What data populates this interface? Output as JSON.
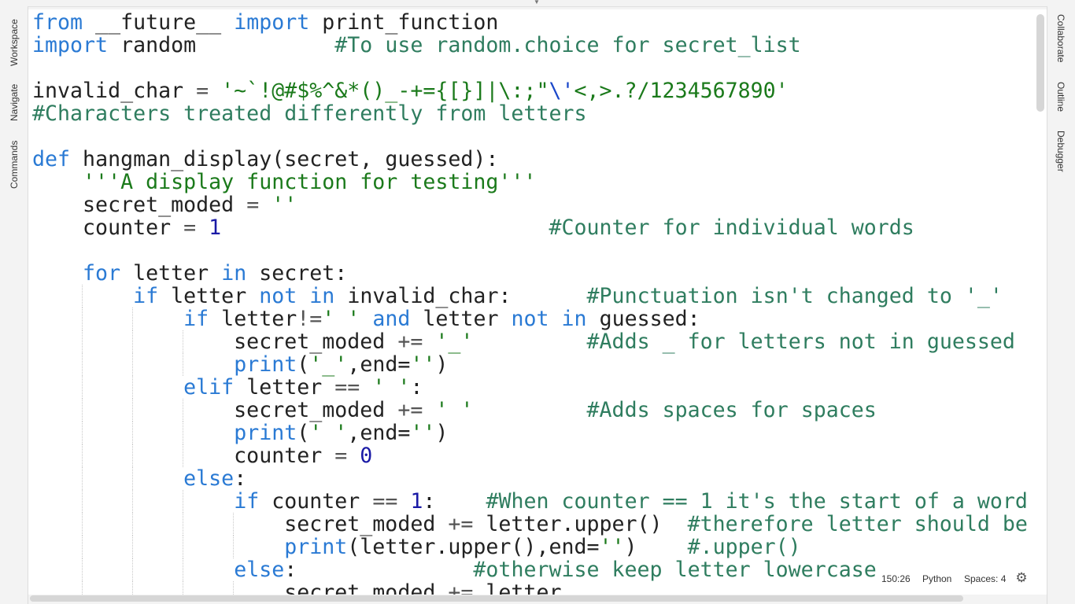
{
  "sidebar_left": {
    "items": [
      "Workspace",
      "Navigate",
      "Commands"
    ]
  },
  "sidebar_right": {
    "items": [
      "Collaborate",
      "Outline",
      "Debugger"
    ]
  },
  "status": {
    "position": "150:26",
    "language": "Python",
    "indent": "Spaces: 4"
  },
  "icons": {
    "settings": "gear-icon",
    "collapse": "chevron-down-icon"
  },
  "code": {
    "lines": [
      [
        {
          "t": "kw",
          "v": "from"
        },
        {
          "t": "",
          "v": " __future__ "
        },
        {
          "t": "kw",
          "v": "import"
        },
        {
          "t": "",
          "v": " print_function"
        }
      ],
      [
        {
          "t": "kw",
          "v": "import"
        },
        {
          "t": "",
          "v": " random           "
        },
        {
          "t": "com",
          "v": "#To use random.choice for secret_list"
        }
      ],
      [],
      [
        {
          "t": "",
          "v": "invalid_char "
        },
        {
          "t": "op",
          "v": "="
        },
        {
          "t": "",
          "v": " "
        },
        {
          "t": "str",
          "v": "'~`!@#$%^&*()_-+={[}]|\\:;\""
        },
        {
          "t": "esc",
          "v": "\\'"
        },
        {
          "t": "str",
          "v": "<,>.?/1234567890'"
        }
      ],
      [
        {
          "t": "com",
          "v": "#Characters treated differently from letters"
        }
      ],
      [],
      [
        {
          "t": "kw",
          "v": "def"
        },
        {
          "t": "",
          "v": " hangman_display(secret, guessed):"
        }
      ],
      [
        {
          "t": "",
          "v": "    "
        },
        {
          "t": "str",
          "v": "'''A display function for testing'''"
        }
      ],
      [
        {
          "t": "",
          "v": "    secret_moded "
        },
        {
          "t": "op",
          "v": "="
        },
        {
          "t": "",
          "v": " "
        },
        {
          "t": "str",
          "v": "''"
        }
      ],
      [
        {
          "t": "",
          "v": "    counter "
        },
        {
          "t": "op",
          "v": "="
        },
        {
          "t": "",
          "v": " "
        },
        {
          "t": "num",
          "v": "1"
        },
        {
          "t": "",
          "v": "                          "
        },
        {
          "t": "com",
          "v": "#Counter for individual words"
        }
      ],
      [],
      [
        {
          "t": "",
          "v": "    "
        },
        {
          "t": "kw",
          "v": "for"
        },
        {
          "t": "",
          "v": " letter "
        },
        {
          "t": "kw",
          "v": "in"
        },
        {
          "t": "",
          "v": " secret:"
        }
      ],
      [
        {
          "t": "",
          "v": "        "
        },
        {
          "t": "kw",
          "v": "if"
        },
        {
          "t": "",
          "v": " letter "
        },
        {
          "t": "kw",
          "v": "not"
        },
        {
          "t": "",
          "v": " "
        },
        {
          "t": "kw",
          "v": "in"
        },
        {
          "t": "",
          "v": " invalid_char:      "
        },
        {
          "t": "com",
          "v": "#Punctuation isn't changed to '_'"
        }
      ],
      [
        {
          "t": "",
          "v": "            "
        },
        {
          "t": "kw",
          "v": "if"
        },
        {
          "t": "",
          "v": " letter"
        },
        {
          "t": "op",
          "v": "!="
        },
        {
          "t": "str",
          "v": "' '"
        },
        {
          "t": "",
          "v": " "
        },
        {
          "t": "kw",
          "v": "and"
        },
        {
          "t": "",
          "v": " letter "
        },
        {
          "t": "kw",
          "v": "not"
        },
        {
          "t": "",
          "v": " "
        },
        {
          "t": "kw",
          "v": "in"
        },
        {
          "t": "",
          "v": " guessed:"
        }
      ],
      [
        {
          "t": "",
          "v": "                secret_moded "
        },
        {
          "t": "op",
          "v": "+="
        },
        {
          "t": "",
          "v": " "
        },
        {
          "t": "str",
          "v": "'_'"
        },
        {
          "t": "",
          "v": "         "
        },
        {
          "t": "com",
          "v": "#Adds _ for letters not in guessed"
        }
      ],
      [
        {
          "t": "",
          "v": "                "
        },
        {
          "t": "kw",
          "v": "print"
        },
        {
          "t": "",
          "v": "("
        },
        {
          "t": "str",
          "v": "'_'"
        },
        {
          "t": "",
          "v": ",end="
        },
        {
          "t": "str",
          "v": "''"
        },
        {
          "t": "",
          "v": ")"
        }
      ],
      [
        {
          "t": "",
          "v": "            "
        },
        {
          "t": "kw",
          "v": "elif"
        },
        {
          "t": "",
          "v": " letter "
        },
        {
          "t": "op",
          "v": "=="
        },
        {
          "t": "",
          "v": " "
        },
        {
          "t": "str",
          "v": "' '"
        },
        {
          "t": "",
          "v": ":"
        }
      ],
      [
        {
          "t": "",
          "v": "                secret_moded "
        },
        {
          "t": "op",
          "v": "+="
        },
        {
          "t": "",
          "v": " "
        },
        {
          "t": "str",
          "v": "' '"
        },
        {
          "t": "",
          "v": "         "
        },
        {
          "t": "com",
          "v": "#Adds spaces for spaces"
        }
      ],
      [
        {
          "t": "",
          "v": "                "
        },
        {
          "t": "kw",
          "v": "print"
        },
        {
          "t": "",
          "v": "("
        },
        {
          "t": "str",
          "v": "' '"
        },
        {
          "t": "",
          "v": ",end="
        },
        {
          "t": "str",
          "v": "''"
        },
        {
          "t": "",
          "v": ")"
        }
      ],
      [
        {
          "t": "",
          "v": "                counter "
        },
        {
          "t": "op",
          "v": "="
        },
        {
          "t": "",
          "v": " "
        },
        {
          "t": "num",
          "v": "0"
        }
      ],
      [
        {
          "t": "",
          "v": "            "
        },
        {
          "t": "kw",
          "v": "else"
        },
        {
          "t": "",
          "v": ":"
        }
      ],
      [
        {
          "t": "",
          "v": "                "
        },
        {
          "t": "kw",
          "v": "if"
        },
        {
          "t": "",
          "v": " counter "
        },
        {
          "t": "op",
          "v": "=="
        },
        {
          "t": "",
          "v": " "
        },
        {
          "t": "num",
          "v": "1"
        },
        {
          "t": "",
          "v": ":    "
        },
        {
          "t": "com",
          "v": "#When counter == 1 it's the start of a word"
        }
      ],
      [
        {
          "t": "",
          "v": "                    secret_moded "
        },
        {
          "t": "op",
          "v": "+="
        },
        {
          "t": "",
          "v": " letter.upper()  "
        },
        {
          "t": "com",
          "v": "#therefore letter should be"
        }
      ],
      [
        {
          "t": "",
          "v": "                    "
        },
        {
          "t": "kw",
          "v": "print"
        },
        {
          "t": "",
          "v": "(letter.upper(),end="
        },
        {
          "t": "str",
          "v": "''"
        },
        {
          "t": "",
          "v": ")    "
        },
        {
          "t": "com",
          "v": "#.upper()"
        }
      ],
      [
        {
          "t": "",
          "v": "                "
        },
        {
          "t": "kw",
          "v": "else"
        },
        {
          "t": "",
          "v": ":              "
        },
        {
          "t": "com",
          "v": "#otherwise keep letter lowercase"
        }
      ],
      [
        {
          "t": "",
          "v": "                    secret_moded "
        },
        {
          "t": "op",
          "v": "+="
        },
        {
          "t": "",
          "v": " letter"
        }
      ]
    ],
    "guides": [
      {
        "line": 12,
        "cols": [
          4
        ]
      },
      {
        "line": 13,
        "cols": [
          4,
          8
        ]
      },
      {
        "line": 14,
        "cols": [
          4,
          8,
          12
        ]
      },
      {
        "line": 15,
        "cols": [
          4,
          8,
          12
        ]
      },
      {
        "line": 16,
        "cols": [
          4,
          8
        ]
      },
      {
        "line": 17,
        "cols": [
          4,
          8,
          12
        ]
      },
      {
        "line": 18,
        "cols": [
          4,
          8,
          12
        ]
      },
      {
        "line": 19,
        "cols": [
          4,
          8,
          12
        ]
      },
      {
        "line": 20,
        "cols": [
          4,
          8
        ]
      },
      {
        "line": 21,
        "cols": [
          4,
          8,
          12
        ]
      },
      {
        "line": 22,
        "cols": [
          4,
          8,
          12,
          16
        ]
      },
      {
        "line": 23,
        "cols": [
          4,
          8,
          12,
          16
        ]
      },
      {
        "line": 24,
        "cols": [
          4,
          8,
          12
        ]
      },
      {
        "line": 25,
        "cols": [
          4,
          8,
          12,
          16
        ]
      }
    ]
  }
}
